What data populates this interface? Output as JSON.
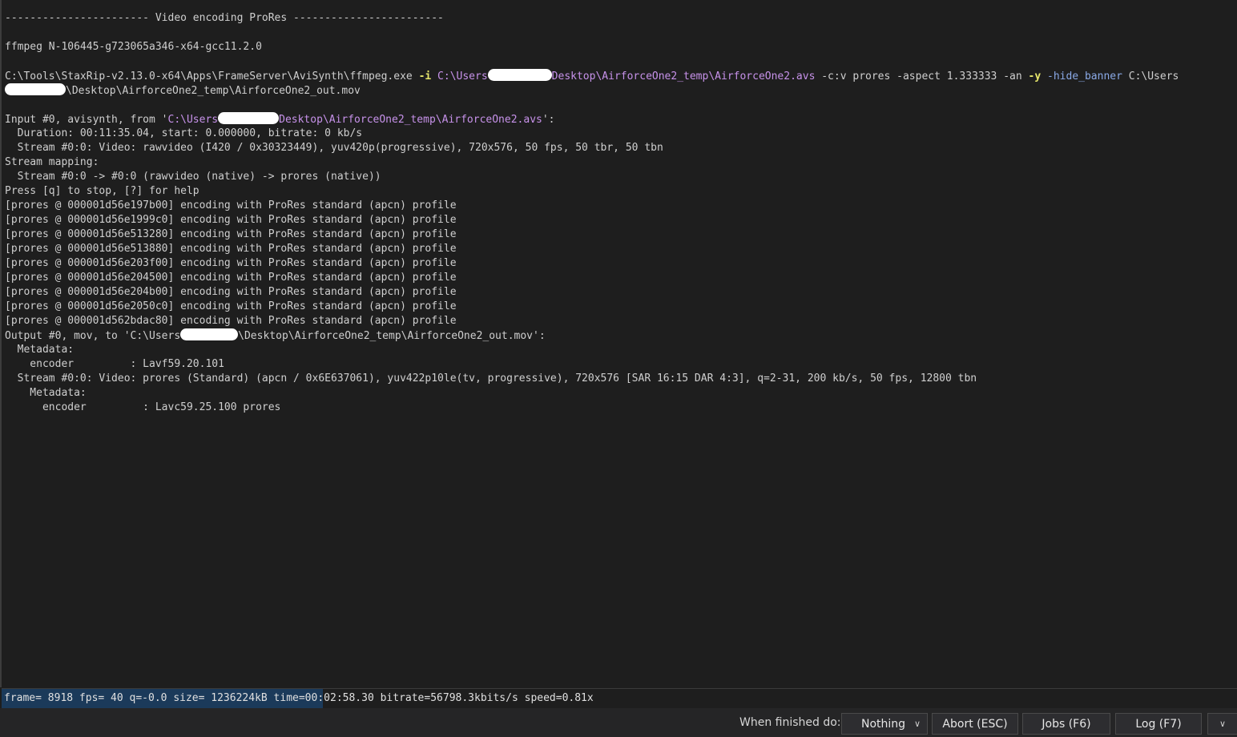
{
  "log": {
    "header": "----------------------- Video encoding ProRes ------------------------",
    "version": "ffmpeg N-106445-g723065a346-x64-gcc11.2.0",
    "command": {
      "exe": "C:\\Tools\\StaxRip-v2.13.0-x64\\Apps\\FrameServer\\AviSynth\\ffmpeg.exe",
      "flag_i": "-i",
      "input_prefix": "C:\\Users",
      "input_suffix": "Desktop\\AirforceOne2_temp\\AirforceOne2.avs",
      "args1": "-c:v prores -aspect 1.333333 -an",
      "flag_y": "-y",
      "opt_banner": "-hide_banner",
      "output_prefix": "C:\\Users",
      "output_suffix": "\\Desktop\\AirforceOne2_temp\\AirforceOne2_out.mov"
    },
    "input_line": {
      "prefix": "Input #0, avisynth, from '",
      "path_prefix": "C:\\Users",
      "path_suffix": "Desktop\\AirforceOne2_temp\\AirforceOne2.avs",
      "end": "':"
    },
    "duration_line": "  Duration: 00:11:35.04, start: 0.000000, bitrate: 0 kb/s",
    "stream_in_line": "  Stream #0:0: Video: rawvideo (I420 / 0x30323449), yuv420p(progressive), 720x576, 50 fps, 50 tbr, 50 tbn",
    "stream_mapping": "Stream mapping:",
    "mapping_detail": "  Stream #0:0 -> #0:0 (rawvideo (native) -> prores (native))",
    "press_help": "Press [q] to stop, [?] for help",
    "encoder_lines": [
      "[prores @ 000001d56e197b00] encoding with ProRes standard (apcn) profile",
      "[prores @ 000001d56e1999c0] encoding with ProRes standard (apcn) profile",
      "[prores @ 000001d56e513280] encoding with ProRes standard (apcn) profile",
      "[prores @ 000001d56e513880] encoding with ProRes standard (apcn) profile",
      "[prores @ 000001d56e203f00] encoding with ProRes standard (apcn) profile",
      "[prores @ 000001d56e204500] encoding with ProRes standard (apcn) profile",
      "[prores @ 000001d56e204b00] encoding with ProRes standard (apcn) profile",
      "[prores @ 000001d56e2050c0] encoding with ProRes standard (apcn) profile",
      "[prores @ 000001d562bdac80] encoding with ProRes standard (apcn) profile"
    ],
    "output_line": {
      "prefix": "Output #0, mov, to 'C:\\Users",
      "suffix": "\\Desktop\\AirforceOne2_temp\\AirforceOne2_out.mov':"
    },
    "metadata1": "  Metadata:",
    "encoder1": "    encoder         : Lavf59.20.101",
    "stream_out_line": "  Stream #0:0: Video: prores (Standard) (apcn / 0x6E637061), yuv422p10le(tv, progressive), 720x576 [SAR 16:15 DAR 4:3], q=2-31, 200 kb/s, 50 fps, 12800 tbn",
    "metadata2": "    Metadata:",
    "encoder2": "      encoder         : Lavc59.25.100 prores"
  },
  "progress": {
    "status_text": "frame= 8918 fps= 40 q=-0.0 size= 1236224kB time=00:02:58.30 bitrate=56798.3kbits/s speed=0.81x",
    "fraction": 0.26
  },
  "bottom": {
    "when_finished_label": "When finished do:",
    "when_finished_value": "Nothing",
    "abort_label": "Abort (ESC)",
    "jobs_label": "Jobs (F6)",
    "log_label": "Log (F7)"
  },
  "colors": {
    "background": "#1e1e1e",
    "text": "#cfcfcf",
    "path": "#c792ea",
    "flag": "#e6e66b",
    "option": "#8aa9e6",
    "progress_fill": "#1b3a5a"
  },
  "icons": {
    "dropdown": "chevron-down-icon",
    "more": "chevron-down-icon"
  }
}
